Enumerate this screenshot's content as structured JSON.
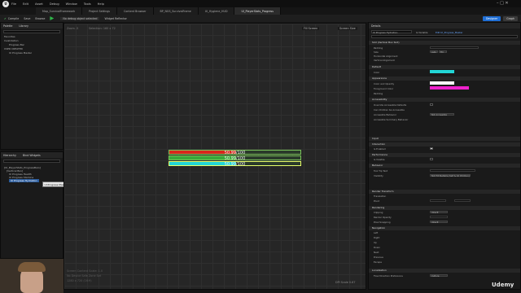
{
  "menu": [
    "File",
    "Edit",
    "Asset",
    "Debug",
    "Window",
    "Tools",
    "Help"
  ],
  "tabs": [
    "Map_SurvivalFramework",
    "Project Settings",
    "Content Browser",
    "BP_NGS_SurvivalFrame",
    "UI_Hygiene_HUD",
    "UI_PlayerStats_Progress"
  ],
  "toolbar": {
    "compile": "Compile",
    "save": "Save",
    "browse": "Browse",
    "debug_filter": "No debug object selected",
    "widget_reflector": "Widget Reflector",
    "designer": "Designer",
    "graph": "Graph"
  },
  "palette": {
    "tabs": [
      "Palette",
      "Library"
    ],
    "search_placeholder": "Search Palette",
    "items": [
      "Favorites",
      "Invalidation",
      "Progress Bar",
      "USER CREATED",
      "UI Progress Master"
    ]
  },
  "hierarchy": {
    "tabs": [
      "Hierarchy",
      "Bind Widgets"
    ],
    "search_placeholder": "Search Widgets",
    "items": [
      "[UI_PlayerStats_ProgressBars]",
      "[Vertical Box]",
      "UI Progress Health",
      "UI Progress Stamina",
      "UI Progress Hydration"
    ],
    "tooltip": "UI Progress Master"
  },
  "viewport": {
    "zoom": "Zoom -5",
    "selection": "Selection: 160 x 72",
    "fill_screen": "Fill Screen",
    "resolution": "Desired on Screen",
    "screen_size": "Screen Size",
    "scale_text": "Screen Content Scale: 1.0",
    "device": "No Device Safe Zone Set",
    "res": "1280 x 720 (16:9)",
    "dpi": "DPI Scale 0.67"
  },
  "bars": [
    {
      "label": "50.99/100",
      "fill_color": "#d8261c",
      "percent": 50.99
    },
    {
      "label": "50.99/100",
      "fill_color": "#3aa83a",
      "percent": 50.99
    },
    {
      "label": "50.99/100",
      "fill_color": "#22d6d6",
      "percent": 50.99
    }
  ],
  "details": {
    "title": "Details",
    "widget_name": "UI Progress Hydration",
    "is_variable": "Is Variable",
    "edit_link": "Edit UI_Progress_Master",
    "sections": [
      "Slot (Vertical Box Slot)",
      "Default",
      "Appearance",
      "Accessibility",
      "Input",
      "Interaction",
      "Performance",
      "Behavior",
      "Render Transform",
      "Rendering",
      "Navigation",
      "Localization"
    ],
    "props": {
      "padding": "Padding",
      "size": "Size",
      "auto": "Auto",
      "fill": "Fill",
      "h_align": "Horizontal Alignment",
      "v_align": "Vertical Alignment",
      "color": "Color",
      "color_and_opacity": "Color and Opacity",
      "foreground_color": "Foreground Color",
      "padding2": "Padding",
      "override_access": "Override Accessible Defaults",
      "can_children": "Can Children be Accessible",
      "access_behavior": "Accessible Behavior",
      "access_summary": "Accessible Summary Behavior",
      "not_accessible": "Not Accessible",
      "is_enabled": "Is Enabled",
      "is_volatile": "Is Volatile",
      "tooltip_text": "Tool Tip Text",
      "visibility": "Visibility",
      "not_hit": "Not Hit-Testable (Self & All Children)",
      "translation": "Translation",
      "pivot": "Pivot",
      "clipping": "Clipping",
      "inherit": "Inherit",
      "render_opacity": "Render Opacity",
      "pixel_snapping": "Pixel Snapping",
      "left": "Left",
      "right": "Right",
      "up": "Up",
      "down": "Down",
      "next": "Next",
      "previous": "Previous",
      "escape": "Escape",
      "flow": "Flow Direction Preference",
      "culture": "Culture",
      "padding_val": "0.0",
      "x_val": "0.0",
      "y_val": "0.0",
      "opacity_val": "1.0",
      "color_hex": "#22d6d6",
      "white": "#ffffff",
      "magenta": "#ee22cc"
    }
  },
  "watermark": "Udemy"
}
